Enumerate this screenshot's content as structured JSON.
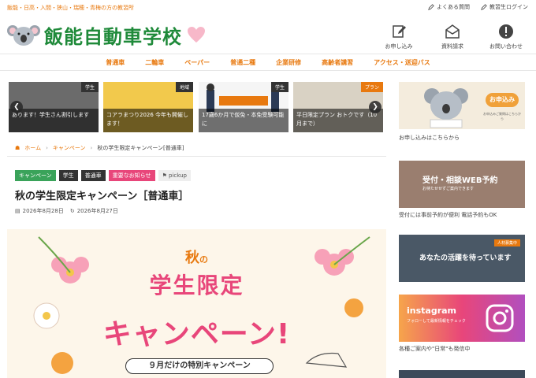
{
  "top": {
    "tagline": "飯能・日高・入間・狭山・瑞穂・青梅の方の教習所",
    "faq": "よくある質問",
    "student_login": "教習生ログイン"
  },
  "header": {
    "logo_text": "飯能自動車学校",
    "icons": [
      {
        "label": "お申し込み",
        "icon": "pencil-note-icon"
      },
      {
        "label": "資料請求",
        "icon": "envelope-icon"
      },
      {
        "label": "お問い合わせ",
        "icon": "exclamation-icon"
      }
    ]
  },
  "nav": [
    "普通車",
    "二輪車",
    "ペーパー",
    "普通二種",
    "企業研修",
    "高齢者講習",
    "アクセス・送迎バス"
  ],
  "carousel": {
    "slides": [
      {
        "tag": "学生",
        "caption": "あります！学生さん割引します",
        "color": "#555555",
        "tagColor": "#333333"
      },
      {
        "tag": "地域",
        "caption": "コアラまつり2026 今年も開催します！",
        "color": "#f2c94c",
        "tagColor": "#333333"
      },
      {
        "tag": "学生",
        "caption": "17歳6か月で仮免・本免受験可能に",
        "color": "#ffffff",
        "tagColor": "#333333"
      },
      {
        "tag": "プラン",
        "caption": "平日限定プラン おトクです（10月まで）",
        "color": "#f5efe4",
        "tagColor": "#e8790f"
      }
    ]
  },
  "breadcrumb": {
    "home": "ホーム",
    "category": "キャンペーン",
    "current": "秋の学生限定キャンペーン[普通車]"
  },
  "tags": [
    {
      "label": "キャンペーン",
      "color": "#3aa35a"
    },
    {
      "label": "学生",
      "color": "#333333"
    },
    {
      "label": "普通車",
      "color": "#333333"
    },
    {
      "label": "重要なお知らせ",
      "color": "#e8467a"
    },
    {
      "label": "pickup",
      "color": "#eeeeee"
    }
  ],
  "post": {
    "title": "秋の学生限定キャンペーン［普通車］",
    "published": "2026年8月28日",
    "updated": "2026年8月27日"
  },
  "hero": {
    "aki": "秋",
    "no": "の",
    "sub": "学生限定",
    "main": "キャンペーン!",
    "month": "９月だけの特別キャンペーン"
  },
  "sidebar": {
    "apply_badge": "お申込み",
    "apply_note": "お申込みご質問はこちらから",
    "apply_caption": "お申し込みはこちらから",
    "web_title": "受付・相談WEB予約",
    "web_sub": "お待たせせずご案内できます",
    "web_caption": "受付には事前予約が便利 電話予約もOK",
    "job_title": "あなたの活躍を待っています",
    "job_tag": "人材募集中",
    "insta_title": "instagram",
    "insta_sub": "フォローして最新情報をチェック",
    "insta_caption": "各種ご案内や\"日常\"も発信中"
  },
  "colors": {
    "accent": "#e8790f",
    "brand_green": "#1f8a3a",
    "pink": "#e8467a"
  }
}
